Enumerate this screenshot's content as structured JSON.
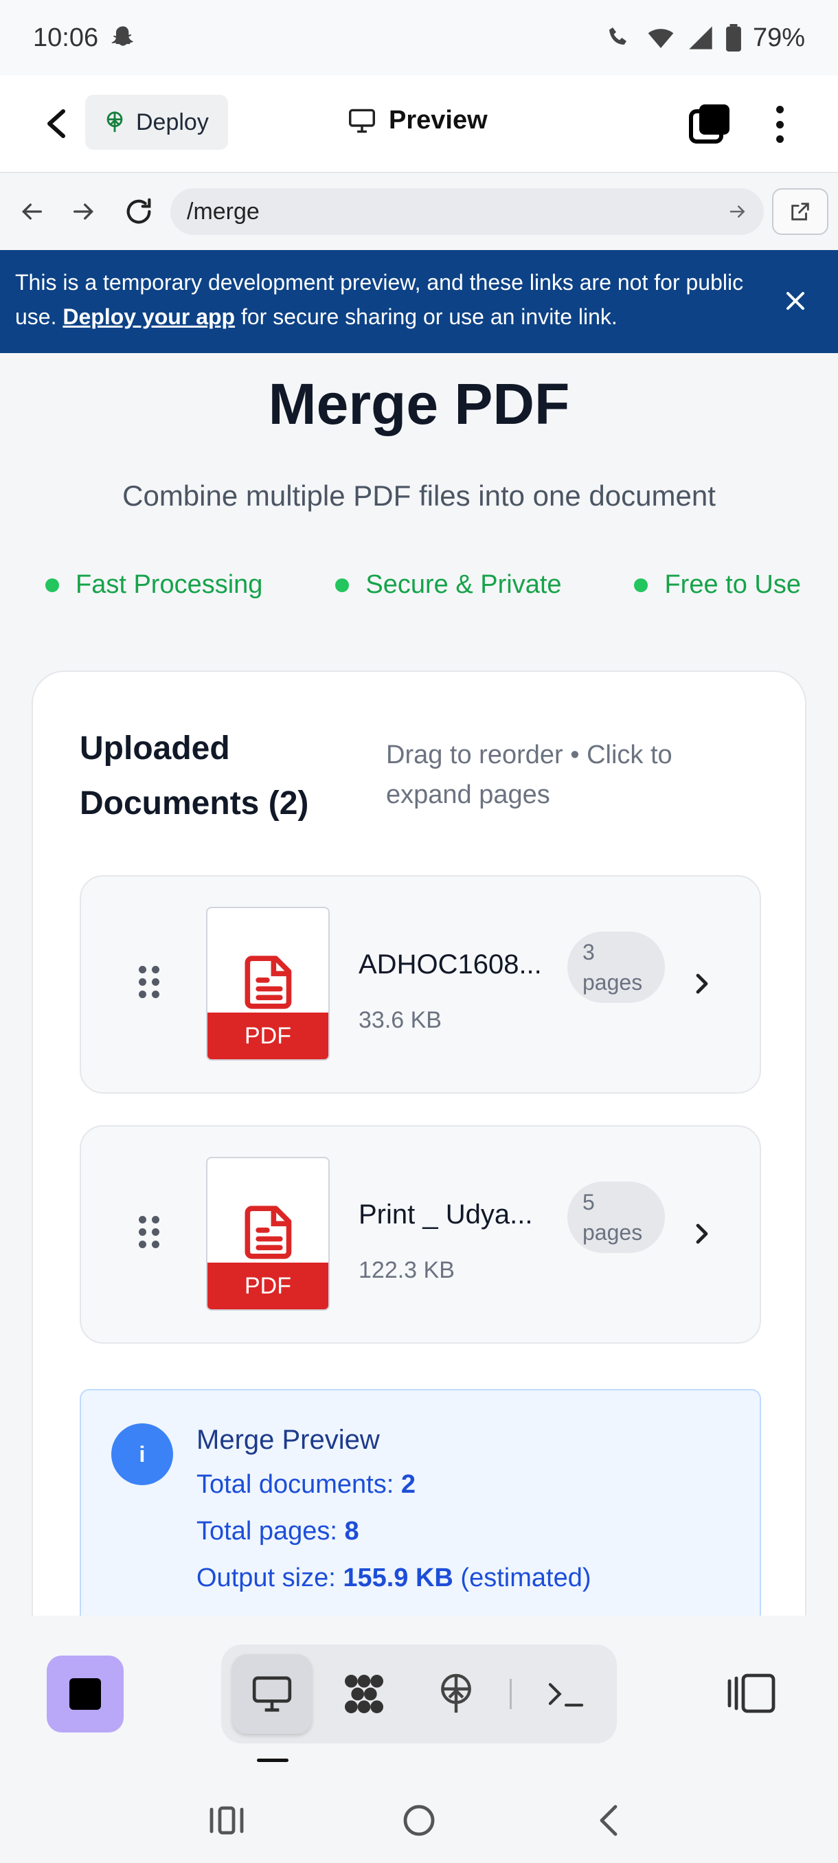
{
  "status": {
    "time": "10:06",
    "battery": "79%"
  },
  "header": {
    "deploy_label": "Deploy",
    "title": "Preview"
  },
  "browser": {
    "url": "/merge"
  },
  "banner": {
    "text_before": "This is a temporary development preview, and these links are not for public use. ",
    "link": "Deploy your app",
    "text_after": " for secure sharing or use an invite link."
  },
  "page": {
    "title": "Merge PDF",
    "subtitle": "Combine multiple PDF files into one document",
    "features": [
      "Fast Processing",
      "Secure & Private",
      "Free to Use"
    ]
  },
  "uploads": {
    "title": "Uploaded Documents (2)",
    "hint": "Drag to reorder • Click to expand pages",
    "files": [
      {
        "name": "ADHOC1608...",
        "size": "33.6 KB",
        "pages_num": "3",
        "pages_label": "pages",
        "badge": "PDF"
      },
      {
        "name": "Print _ Udya...",
        "size": "122.3 KB",
        "pages_num": "5",
        "pages_label": "pages",
        "badge": "PDF"
      }
    ]
  },
  "merge_preview": {
    "title": "Merge Preview",
    "icon_letter": "i",
    "docs_label": "Total documents: ",
    "docs_value": "2",
    "pages_label": "Total pages: ",
    "pages_value": "8",
    "size_label": "Output size: ",
    "size_value": "155.9 KB",
    "size_note": " (estimated)"
  },
  "colors": {
    "banner": "#0d4286",
    "feature_green": "#16a34a",
    "pdf_red": "#dc2626",
    "info_blue": "#3b82f6",
    "stop_purple": "#b9a7f7"
  }
}
